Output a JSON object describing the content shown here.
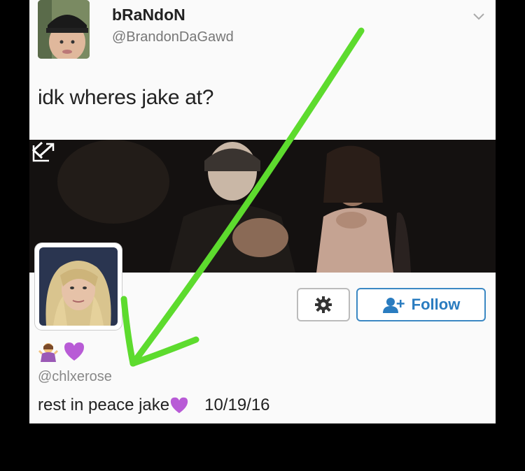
{
  "tweet": {
    "display_name": "bRaNdoN",
    "handle": "@BrandonDaGawd",
    "text": "idk wheres jake at?"
  },
  "profile": {
    "follow_label": "Follow",
    "handle": "@chlxerose",
    "post_text": "rest in peace jake",
    "post_date": "10/19/16"
  },
  "icons": {
    "menu": "chevron-down-icon",
    "back": "chevron-left-icon",
    "expand": "expand-icon",
    "settings": "gear-icon",
    "follow": "add-user-icon",
    "emoji1": "person-shrugging-emoji",
    "emoji2": "purple-heart-emoji"
  },
  "colors": {
    "follow_accent": "#2a7cc0",
    "arrow": "#5ddb2e",
    "heart": "#b85bd6"
  }
}
